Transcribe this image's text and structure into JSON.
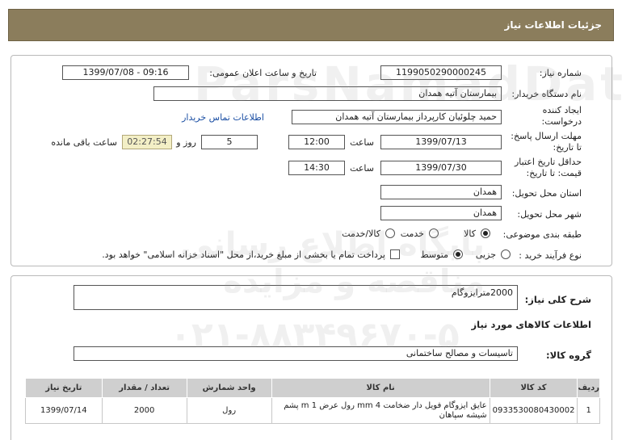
{
  "header": {
    "title": "جزئیات اطلاعات نیاز"
  },
  "form": {
    "need_number_label": "شماره نیاز:",
    "need_number": "1199050290000245",
    "announce_label": "تاریخ و ساعت اعلان عمومی:",
    "announce_value": "1399/07/08 - 09:16",
    "buyer_org_label": "نام دستگاه خریدار:",
    "buyer_org": "بیمارستان آتیه همدان",
    "creator_label_1": "ایجاد کننده",
    "creator_label_2": "درخواست:",
    "creator": "حمید چلوئیان  کارپرداز بیمارستان آتیه همدان",
    "contact_link": "اطلاعات تماس خریدار",
    "reply_label_1": "مهلت ارسال پاسخ:",
    "reply_label_2": "تا تاریخ:",
    "reply_date": "1399/07/13",
    "time_label": "ساعت",
    "reply_time": "12:00",
    "days_value": "5",
    "days_label": "روز و",
    "remaining_time": "02:27:54",
    "remaining_label": "ساعت باقی مانده",
    "validity_label_1": "حداقل تاریخ اعتبار",
    "validity_label_2": "قیمت: تا تاریخ:",
    "validity_date": "1399/07/30",
    "validity_time": "14:30",
    "province_label": "استان محل تحویل:",
    "province": "همدان",
    "city_label": "شهر محل تحویل:",
    "city": "همدان",
    "category_label": "طبقه بندی موضوعی:",
    "category_options": [
      "کالا",
      "خدمت",
      "کالا/خدمت"
    ],
    "purchase_label": "نوع فرآیند خرید :",
    "purchase_options": [
      "جزیی",
      "متوسط"
    ],
    "payment_note": "پرداخت تمام یا بخشی از مبلغ خرید،از محل \"اسناد خزانه اسلامی\" خواهد بود."
  },
  "details": {
    "summary_label": "شرح کلی نیاز:",
    "summary": "2000مترایزوگام",
    "goods_info_title": "اطلاعات کالاهای مورد نیاز",
    "group_label": "گروه کالا:",
    "group": "تاسیسات و مصالح ساختمانی",
    "table": {
      "headers": [
        "ردیف",
        "کد کالا",
        "نام کالا",
        "واحد شمارش",
        "تعداد / مقدار",
        "تاریخ نیاز"
      ],
      "rows": [
        {
          "row": "1",
          "code": "0933530080430002",
          "name": "عایق ایزوگام فویل دار ضخامت mm 4 رول عرض m 1 پشم شیشه سپاهان",
          "unit": "رول",
          "qty": "2000",
          "date": "1399/07/14"
        }
      ]
    }
  },
  "watermark": {
    "line1": "ParsNamadData",
    "line2": "پایگاه اطلاع رسانی مناقصه و مزایده",
    "line3": "۰۲۱-۸۸۳۴۹۶۷۰-۵"
  }
}
